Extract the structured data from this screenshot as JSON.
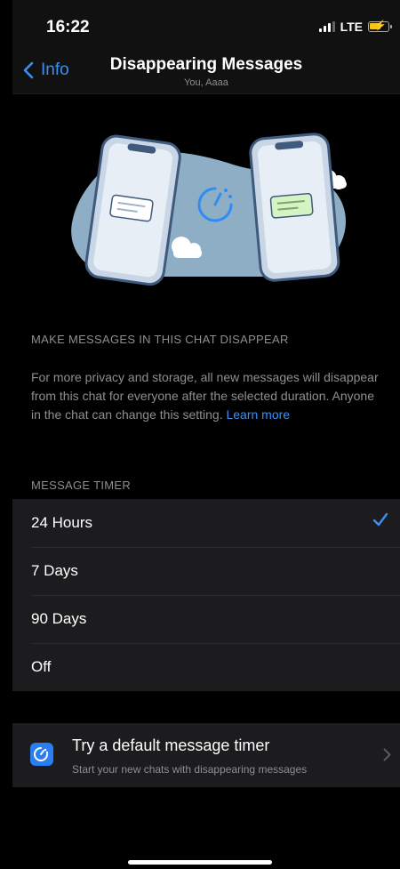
{
  "status_bar": {
    "time": "16:22",
    "network": "LTE"
  },
  "nav": {
    "back_label": "Info",
    "title": "Disappearing Messages",
    "subtitle": "You, Aaaa"
  },
  "section": {
    "heading": "MAKE MESSAGES IN THIS CHAT DISAPPEAR",
    "description": "For more privacy and storage, all new messages will disappear from this chat for everyone after the selected duration. Anyone in the chat can change this setting.",
    "learn_more": "Learn more"
  },
  "timer": {
    "heading": "MESSAGE TIMER",
    "options": [
      {
        "label": "24 Hours",
        "selected": true
      },
      {
        "label": "7 Days",
        "selected": false
      },
      {
        "label": "90 Days",
        "selected": false
      },
      {
        "label": "Off",
        "selected": false
      }
    ]
  },
  "default_timer": {
    "title": "Try a default message timer",
    "subtitle": "Start your new chats with disappearing messages"
  },
  "colors": {
    "accent": "#3b8ff3",
    "background": "#000000",
    "cell": "#1c1c1e",
    "secondary_text": "#8e8e93"
  },
  "icons": [
    "signal-icon",
    "battery-icon",
    "back-chevron-icon",
    "timer-icon",
    "checkmark-icon",
    "chevron-right-icon"
  ]
}
